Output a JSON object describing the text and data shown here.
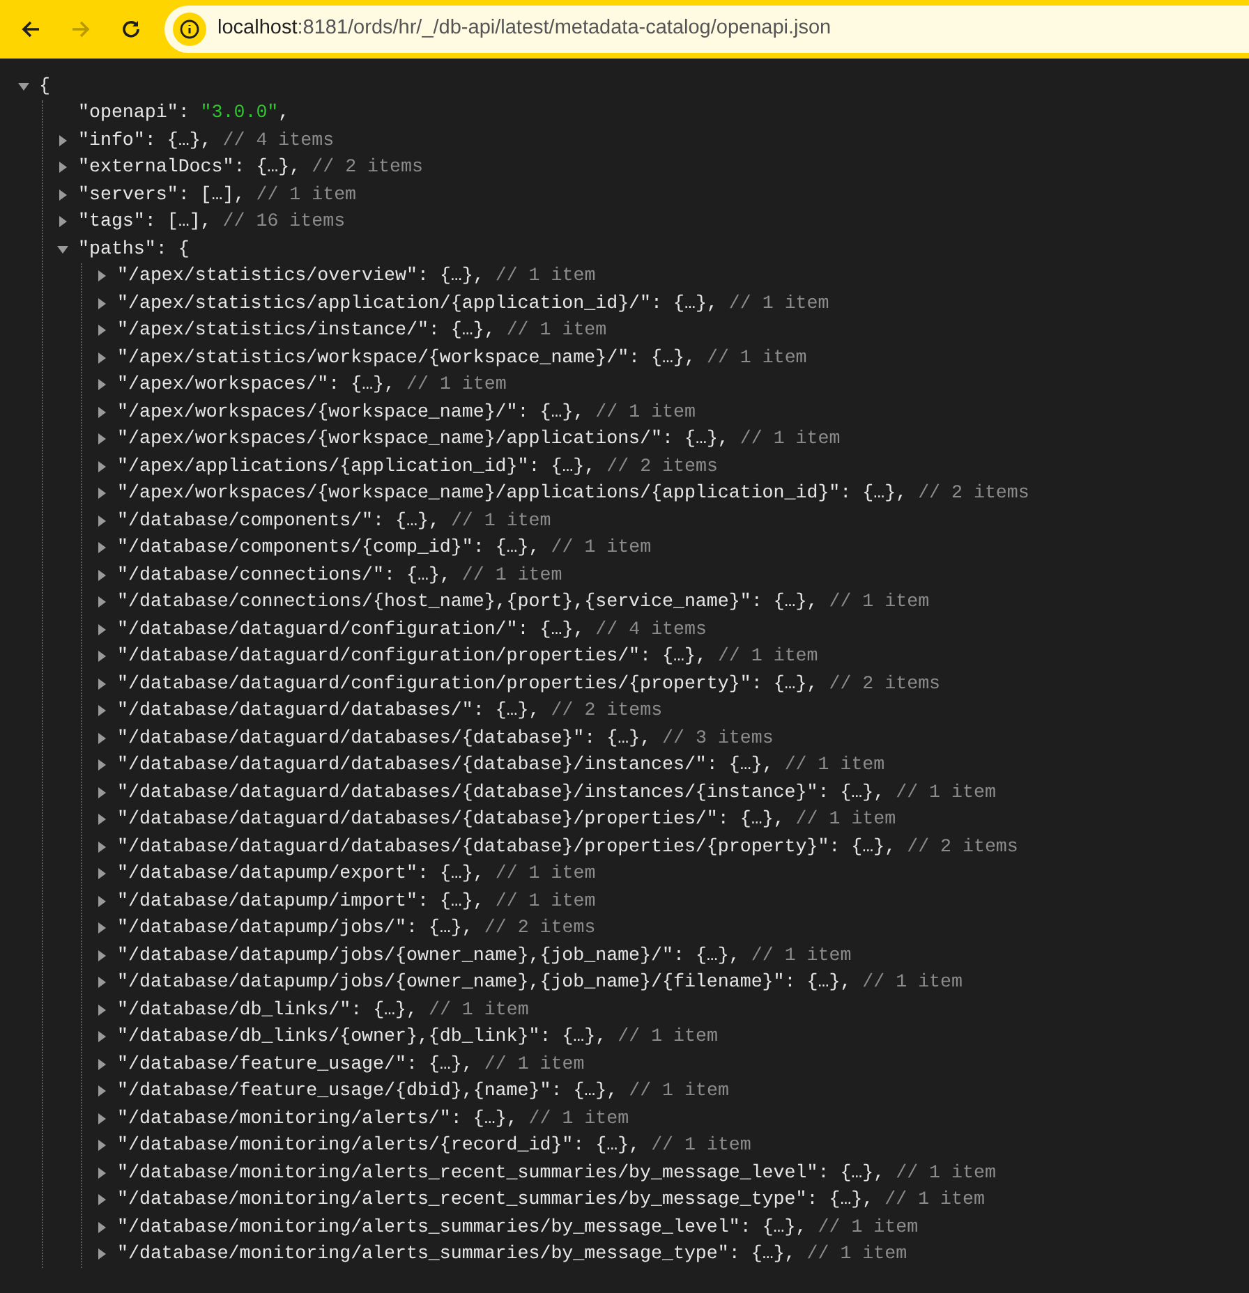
{
  "toolbar": {
    "back_disabled": false,
    "forward_disabled": true,
    "url_host": "localhost",
    "url_path": ":8181/ords/hr/_/db-api/latest/metadata-catalog/openapi.json"
  },
  "tree": {
    "kind": "object",
    "open": "{",
    "expanded": true,
    "children": [
      {
        "kind": "string",
        "key": "\"openapi\":",
        "value": "\"3.0.0\"",
        "after": ","
      },
      {
        "kind": "object",
        "key": "\"info\":",
        "value": "{…},",
        "comment": "// 4 items",
        "expanded": false
      },
      {
        "kind": "object",
        "key": "\"externalDocs\":",
        "value": "{…},",
        "comment": "// 2 items",
        "expanded": false
      },
      {
        "kind": "object",
        "key": "\"servers\":",
        "value": "[…],",
        "comment": "// 1 item",
        "expanded": false
      },
      {
        "kind": "object",
        "key": "\"tags\":",
        "value": "[…],",
        "comment": "// 16 items",
        "expanded": false
      },
      {
        "kind": "object",
        "key": "\"paths\":",
        "open": "{",
        "expanded": true,
        "children": [
          {
            "kind": "object",
            "key": "\"/apex/statistics/overview\":",
            "value": "{…},",
            "comment": "// 1 item",
            "expanded": false
          },
          {
            "kind": "object",
            "key": "\"/apex/statistics/application/{application_id}/\":",
            "value": "{…},",
            "comment": "// 1 item",
            "expanded": false
          },
          {
            "kind": "object",
            "key": "\"/apex/statistics/instance/\":",
            "value": "{…},",
            "comment": "// 1 item",
            "expanded": false
          },
          {
            "kind": "object",
            "key": "\"/apex/statistics/workspace/{workspace_name}/\":",
            "value": "{…},",
            "comment": "// 1 item",
            "expanded": false
          },
          {
            "kind": "object",
            "key": "\"/apex/workspaces/\":",
            "value": "{…},",
            "comment": "// 1 item",
            "expanded": false
          },
          {
            "kind": "object",
            "key": "\"/apex/workspaces/{workspace_name}/\":",
            "value": "{…},",
            "comment": "// 1 item",
            "expanded": false
          },
          {
            "kind": "object",
            "key": "\"/apex/workspaces/{workspace_name}/applications/\":",
            "value": "{…},",
            "comment": "// 1 item",
            "expanded": false
          },
          {
            "kind": "object",
            "key": "\"/apex/applications/{application_id}\":",
            "value": "{…},",
            "comment": "// 2 items",
            "expanded": false
          },
          {
            "kind": "object",
            "key": "\"/apex/workspaces/{workspace_name}/applications/{application_id}\":",
            "value": "{…},",
            "comment": "// 2 items",
            "expanded": false
          },
          {
            "kind": "object",
            "key": "\"/database/components/\":",
            "value": "{…},",
            "comment": "// 1 item",
            "expanded": false
          },
          {
            "kind": "object",
            "key": "\"/database/components/{comp_id}\":",
            "value": "{…},",
            "comment": "// 1 item",
            "expanded": false
          },
          {
            "kind": "object",
            "key": "\"/database/connections/\":",
            "value": "{…},",
            "comment": "// 1 item",
            "expanded": false
          },
          {
            "kind": "object",
            "key": "\"/database/connections/{host_name},{port},{service_name}\":",
            "value": "{…},",
            "comment": "// 1 item",
            "expanded": false
          },
          {
            "kind": "object",
            "key": "\"/database/dataguard/configuration/\":",
            "value": "{…},",
            "comment": "// 4 items",
            "expanded": false
          },
          {
            "kind": "object",
            "key": "\"/database/dataguard/configuration/properties/\":",
            "value": "{…},",
            "comment": "// 1 item",
            "expanded": false
          },
          {
            "kind": "object",
            "key": "\"/database/dataguard/configuration/properties/{property}\":",
            "value": "{…},",
            "comment": "// 2 items",
            "expanded": false
          },
          {
            "kind": "object",
            "key": "\"/database/dataguard/databases/\":",
            "value": "{…},",
            "comment": "// 2 items",
            "expanded": false
          },
          {
            "kind": "object",
            "key": "\"/database/dataguard/databases/{database}\":",
            "value": "{…},",
            "comment": "// 3 items",
            "expanded": false
          },
          {
            "kind": "object",
            "key": "\"/database/dataguard/databases/{database}/instances/\":",
            "value": "{…},",
            "comment": "// 1 item",
            "expanded": false
          },
          {
            "kind": "object",
            "key": "\"/database/dataguard/databases/{database}/instances/{instance}\":",
            "value": "{…},",
            "comment": "// 1 item",
            "expanded": false
          },
          {
            "kind": "object",
            "key": "\"/database/dataguard/databases/{database}/properties/\":",
            "value": "{…},",
            "comment": "// 1 item",
            "expanded": false
          },
          {
            "kind": "object",
            "key": "\"/database/dataguard/databases/{database}/properties/{property}\":",
            "value": "{…},",
            "comment": "// 2 items",
            "expanded": false
          },
          {
            "kind": "object",
            "key": "\"/database/datapump/export\":",
            "value": "{…},",
            "comment": "// 1 item",
            "expanded": false
          },
          {
            "kind": "object",
            "key": "\"/database/datapump/import\":",
            "value": "{…},",
            "comment": "// 1 item",
            "expanded": false
          },
          {
            "kind": "object",
            "key": "\"/database/datapump/jobs/\":",
            "value": "{…},",
            "comment": "// 2 items",
            "expanded": false
          },
          {
            "kind": "object",
            "key": "\"/database/datapump/jobs/{owner_name},{job_name}/\":",
            "value": "{…},",
            "comment": "// 1 item",
            "expanded": false
          },
          {
            "kind": "object",
            "key": "\"/database/datapump/jobs/{owner_name},{job_name}/{filename}\":",
            "value": "{…},",
            "comment": "// 1 item",
            "expanded": false
          },
          {
            "kind": "object",
            "key": "\"/database/db_links/\":",
            "value": "{…},",
            "comment": "// 1 item",
            "expanded": false
          },
          {
            "kind": "object",
            "key": "\"/database/db_links/{owner},{db_link}\":",
            "value": "{…},",
            "comment": "// 1 item",
            "expanded": false
          },
          {
            "kind": "object",
            "key": "\"/database/feature_usage/\":",
            "value": "{…},",
            "comment": "// 1 item",
            "expanded": false
          },
          {
            "kind": "object",
            "key": "\"/database/feature_usage/{dbid},{name}\":",
            "value": "{…},",
            "comment": "// 1 item",
            "expanded": false
          },
          {
            "kind": "object",
            "key": "\"/database/monitoring/alerts/\":",
            "value": "{…},",
            "comment": "// 1 item",
            "expanded": false
          },
          {
            "kind": "object",
            "key": "\"/database/monitoring/alerts/{record_id}\":",
            "value": "{…},",
            "comment": "// 1 item",
            "expanded": false
          },
          {
            "kind": "object",
            "key": "\"/database/monitoring/alerts_recent_summaries/by_message_level\":",
            "value": "{…},",
            "comment": "// 1 item",
            "expanded": false
          },
          {
            "kind": "object",
            "key": "\"/database/monitoring/alerts_recent_summaries/by_message_type\":",
            "value": "{…},",
            "comment": "// 1 item",
            "expanded": false
          },
          {
            "kind": "object",
            "key": "\"/database/monitoring/alerts_summaries/by_message_level\":",
            "value": "{…},",
            "comment": "// 1 item",
            "expanded": false
          },
          {
            "kind": "object",
            "key": "\"/database/monitoring/alerts_summaries/by_message_type\":",
            "value": "{…},",
            "comment": "// 1 item",
            "expanded": false
          }
        ]
      }
    ]
  }
}
